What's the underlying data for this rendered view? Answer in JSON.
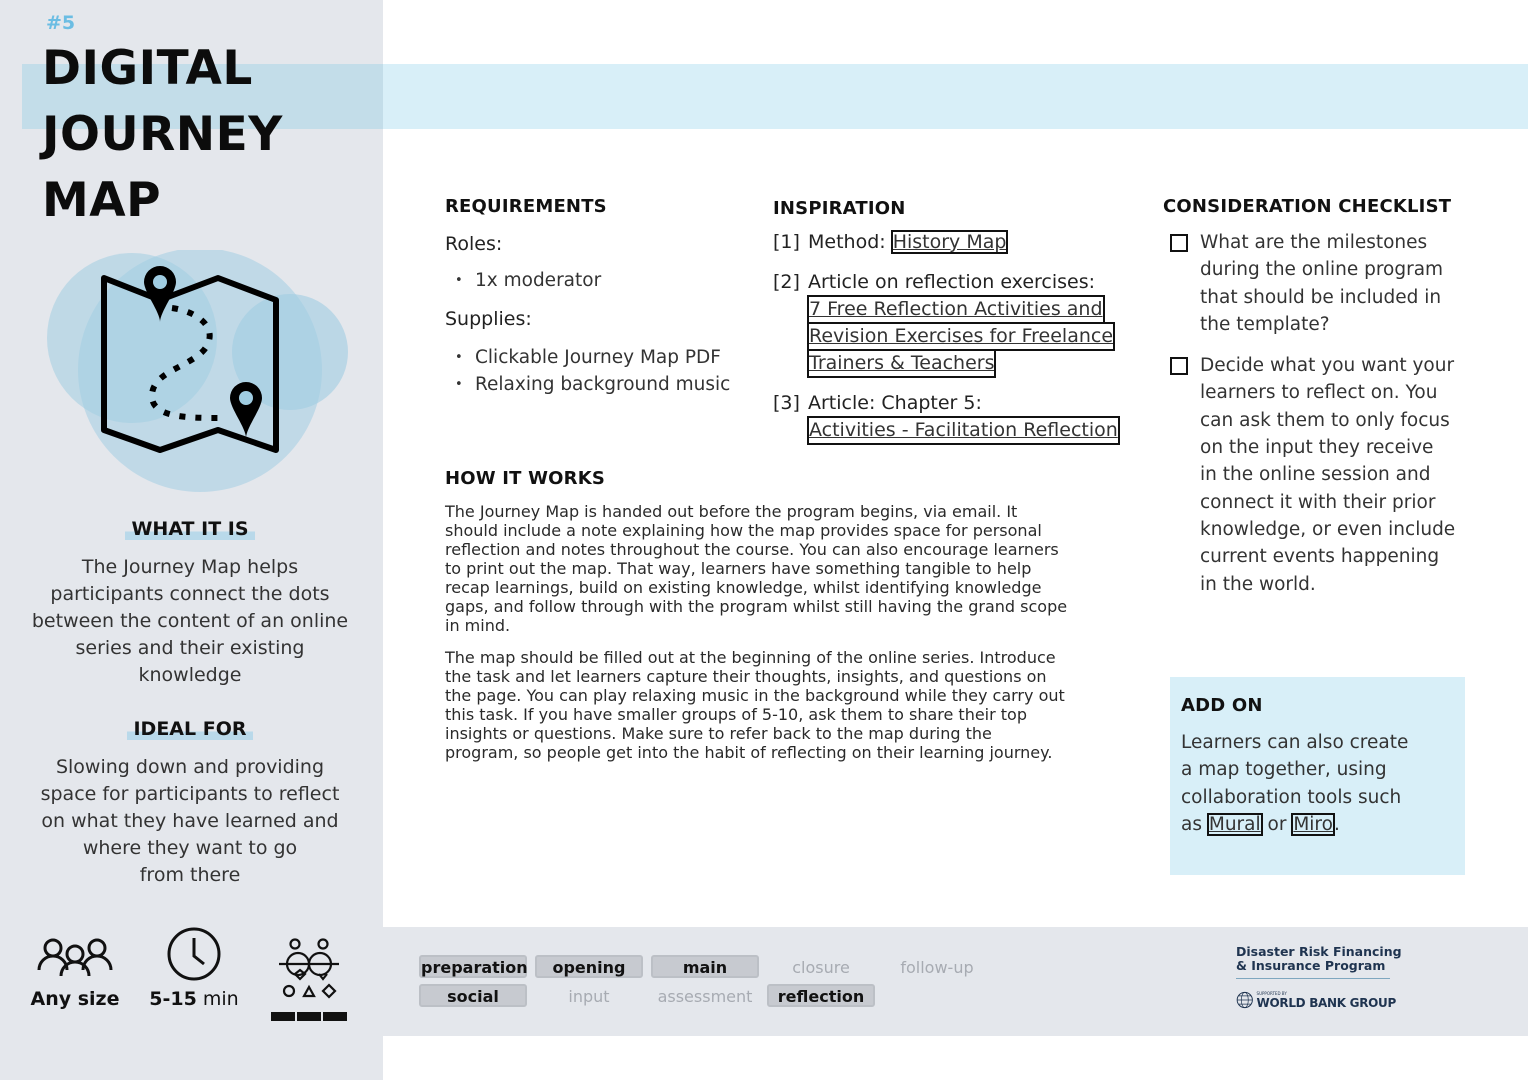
{
  "header": {
    "number": "#5",
    "title_lines": [
      "DIGITAL",
      "JOURNEY",
      "MAP"
    ]
  },
  "sidebar": {
    "illustration": "map-with-pins-icon",
    "what_it_is": {
      "heading": "WHAT IT IS",
      "lines": [
        "The Journey Map helps",
        "participants connect the dots",
        "between the content of an online",
        "series and their existing",
        "knowledge"
      ]
    },
    "ideal_for": {
      "heading": "IDEAL FOR",
      "lines": [
        "Slowing down and providing",
        "space for participants to reflect",
        "on what they have learned and",
        "where they want to go",
        "from there"
      ]
    },
    "meta": {
      "group_size": {
        "icon": "people-group-icon",
        "label": "Any size"
      },
      "duration": {
        "icon": "clock-icon",
        "value": "5-15",
        "unit": " min"
      },
      "intensity": {
        "icon": "interaction-icon",
        "level_filled": 3,
        "level_max": 3
      }
    }
  },
  "requirements": {
    "heading": "REQUIREMENTS",
    "roles_label": "Roles:",
    "roles": [
      "1x moderator"
    ],
    "supplies_label": "Supplies:",
    "supplies": [
      "Clickable Journey Map PDF",
      "Relaxing background music"
    ]
  },
  "inspiration": {
    "heading": "INSPIRATION",
    "items": [
      {
        "num": "[1]",
        "label": "Method: ",
        "links": [
          "History Map"
        ]
      },
      {
        "num": "[2]",
        "label": "Article on reflection exercises:",
        "links": [
          "7 Free Reflection Activities and",
          "Revision Exercises for Freelance",
          "Trainers & Teachers"
        ]
      },
      {
        "num": "[3]",
        "label": "Article: Chapter 5:",
        "links": [
          "Activities - Facilitation Reflection"
        ]
      }
    ]
  },
  "how_it_works": {
    "heading": "HOW IT WORKS",
    "paragraphs": [
      [
        "The Journey Map is handed out before the program begins, via email. It",
        "should include a note explaining how the map provides space for personal",
        "reflection and notes throughout the course. You can also encourage learners",
        "to print out the map. That way, learners have something tangible to help",
        "recap learnings, build on existing knowledge, whilst identifying knowledge",
        "gaps, and follow through with the program whilst still having the grand scope",
        "in mind."
      ],
      [
        "The map should be filled out at the beginning of the online series. Introduce",
        "the task and let learners capture their thoughts, insights, and questions on",
        "the page. You can play relaxing music in the background while they carry out",
        "this task. If you have smaller groups of 5-10, ask them to share their top",
        "insights or questions. Make sure to refer back to the map during the",
        "program, so people get into the habit of reflecting on their learning journey."
      ]
    ]
  },
  "checklist": {
    "heading": "CONSIDERATION CHECKLIST",
    "items": [
      {
        "checked": false,
        "lines": [
          "What are the milestones",
          "during the online program",
          "that should be included in",
          "the template?"
        ]
      },
      {
        "checked": false,
        "lines": [
          "Decide what you want your",
          "learners to reflect on. You",
          "can ask them to only focus",
          "on the input they receive",
          "in the online session and",
          "connect it with their prior",
          "knowledge, or even include",
          "current events happening",
          "in the world."
        ]
      }
    ]
  },
  "add_on": {
    "heading": "ADD ON",
    "lines": [
      "Learners can also create",
      "a map together, using",
      "collaboration tools such"
    ],
    "last_prefix": "as ",
    "link1": "Mural",
    "middle": " or ",
    "link2": "Miro",
    "suffix": "."
  },
  "footer": {
    "tags_row1": [
      {
        "label": "preparation",
        "active": true
      },
      {
        "label": "opening",
        "active": true
      },
      {
        "label": "main",
        "active": true
      },
      {
        "label": "closure",
        "active": false
      },
      {
        "label": "follow-up",
        "active": false
      }
    ],
    "tags_row2": [
      {
        "label": "social",
        "active": true
      },
      {
        "label": "input",
        "active": false
      },
      {
        "label": "assessment",
        "active": false
      },
      {
        "label": "reflection",
        "active": true
      }
    ],
    "logo": {
      "program_line1": "Disaster Risk Financing",
      "program_line2": "& Insurance Program",
      "supported_by": "SUPPORTED BY",
      "org": "WORLD BANK GROUP"
    }
  },
  "colors": {
    "accent_blue": "#6bbde3",
    "banner": "#d8eff8",
    "sidebar_bg": "#e4e7ec",
    "heading_highlight": "#b9d9ea"
  }
}
